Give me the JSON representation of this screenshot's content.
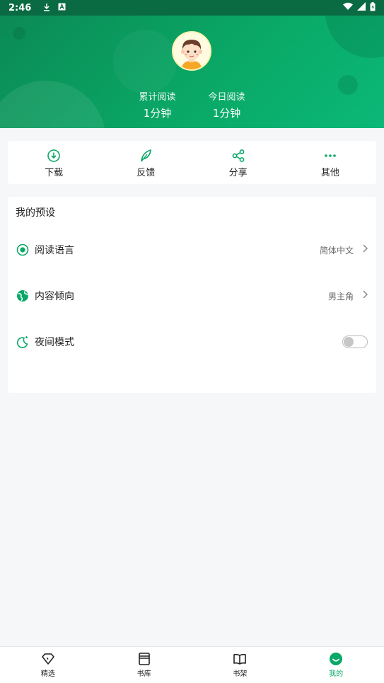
{
  "status_bar": {
    "time": "2:46"
  },
  "header": {
    "stats": [
      {
        "label": "累计阅读",
        "value": "1分钟"
      },
      {
        "label": "今日阅读",
        "value": "1分钟"
      }
    ]
  },
  "actions": [
    {
      "label": "下载",
      "icon": "download-icon"
    },
    {
      "label": "反馈",
      "icon": "feather-icon"
    },
    {
      "label": "分享",
      "icon": "share-icon"
    },
    {
      "label": "其他",
      "icon": "more-icon"
    }
  ],
  "preferences": {
    "title": "我的预设",
    "items": [
      {
        "label": "阅读语言",
        "value": "简体中文",
        "icon": "eye-icon"
      },
      {
        "label": "内容倾向",
        "value": "男主角",
        "icon": "globe-icon"
      },
      {
        "label": "夜间模式",
        "icon": "moon-icon",
        "toggle": false
      }
    ]
  },
  "tabbar": [
    {
      "label": "精选",
      "icon": "diamond-icon",
      "active": false
    },
    {
      "label": "书库",
      "icon": "library-icon",
      "active": false
    },
    {
      "label": "书架",
      "icon": "book-icon",
      "active": false
    },
    {
      "label": "我的",
      "icon": "smile-icon",
      "active": true
    }
  ],
  "colors": {
    "accent": "#0aa866",
    "header_dark": "#0a6b42"
  }
}
